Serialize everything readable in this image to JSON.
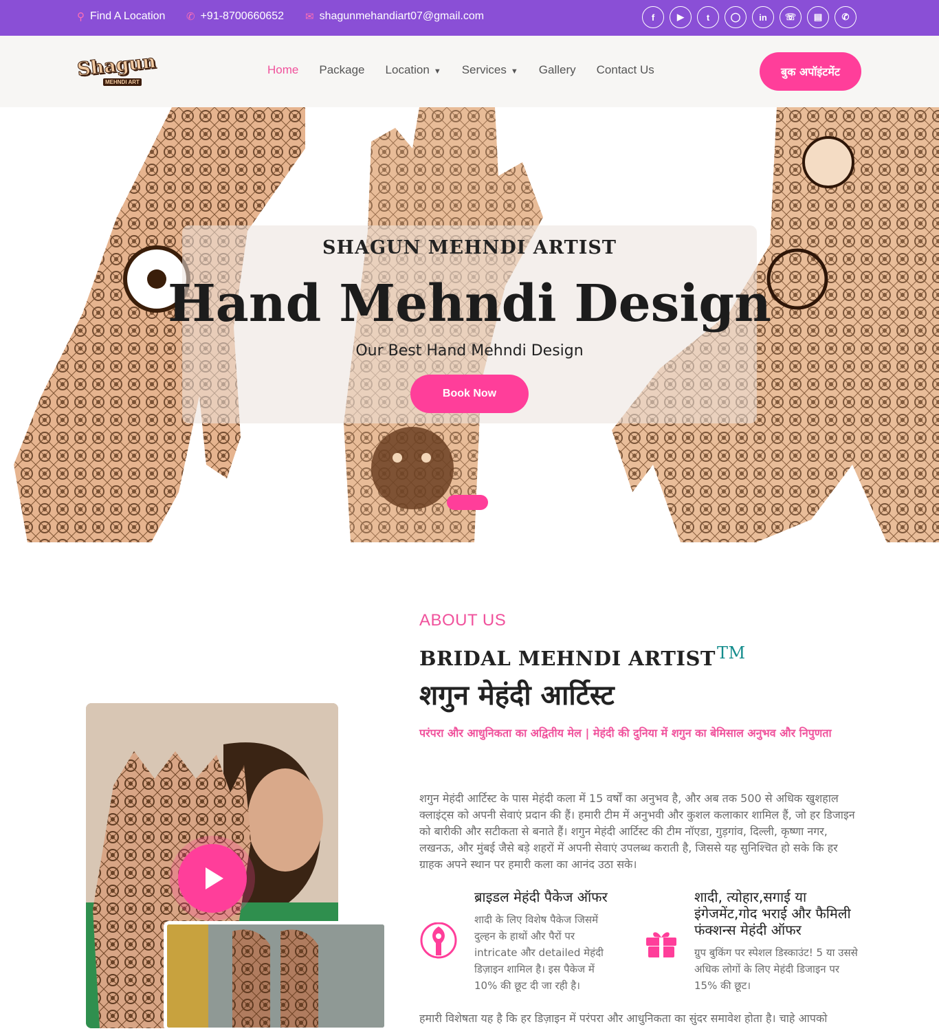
{
  "topbar": {
    "location": "Find A Location",
    "phone": "+91-8700660652",
    "email": "shagunmehandiart07@gmail.com",
    "socials": [
      "facebook",
      "youtube",
      "twitter",
      "instagram",
      "linkedin",
      "whatsapp",
      "blog",
      "phone"
    ]
  },
  "logo": {
    "main": "Shagun",
    "sub": "MEHNDI ART"
  },
  "nav": {
    "items": [
      "Home",
      "Package",
      "Location",
      "Services",
      "Gallery",
      "Contact Us"
    ],
    "cta": "बुक अपॉइंटमेंट"
  },
  "hero": {
    "kicker": "SHAGUN MEHNDI ARTIST",
    "title": "Hand Mehndi Design",
    "subtitle": "Our Best Hand Mehndi Design",
    "button": "Book Now"
  },
  "about": {
    "label": "ABOUT US",
    "heading": "BRIDAL MEHNDI ARTIST",
    "tm": "TM",
    "heading_hindi": "शगुन मेहंदी आर्टिस्ट",
    "tagline": "परंपरा और आधुनिकता का अद्वितीय मेल | मेहंदी की दुनिया में शगुन का बेमिसाल अनुभव और निपुणता",
    "paragraph": "शगुन मेहंदी आर्टिस्ट के पास मेहंदी कला में 15 वर्षों का अनुभव है, और अब तक 500 से अधिक खुशहाल क्लाइंट्स को अपनी सेवाएं प्रदान की हैं। हमारी टीम में अनुभवी और कुशल कलाकार शामिल हैं, जो हर डिजाइन को बारीकी और सटीकता से बनाते हैं। शगुन मेहंदी आर्टिस्ट की टीम नॉएडा, गुड़गांव, दिल्ली, कृष्णा नगर, लखनऊ, और मुंबई जैसे बड़े शहरों में अपनी सेवाएं उपलब्ध कराती है, जिससे यह सुनिश्चित हो सके कि हर ग्राहक अपने स्थान पर हमारी कला का आनंद उठा सके।",
    "features": [
      {
        "title": "ब्राइडल मेहंदी पैकेज ऑफर",
        "text": "शादी के लिए विशेष पैकेज जिसमें दुल्हन के हाथों और पैरों पर intricate और detailed मेहंदी डिज़ाइन शामिल है। इस पैकेज में 10% की छूट दी जा रही है।",
        "icon": "henna-cone-icon"
      },
      {
        "title": "शादी, त्योहार,सगाई या इंगेजमेंट,गोद भराई और फैमिली फंक्शन्स मेहंदी ऑफर",
        "text": "ग्रुप बुकिंग पर स्पेशल डिस्काउंट! 5 या उससे अधिक लोगों के लिए मेहंदी डिजाइन पर 15% की छूट।",
        "icon": "gift-icon"
      }
    ],
    "tail": "हमारी विशेषता यह है कि हर डिज़ाइन में परंपरा और आधुनिकता का सुंदर समावेश होता है। चाहे आपको"
  },
  "colors": {
    "topbar": "#8a4fd6",
    "accent": "#ff3e9a",
    "accent_text": "#f0529c",
    "navbar_bg": "#f7f6f4"
  }
}
